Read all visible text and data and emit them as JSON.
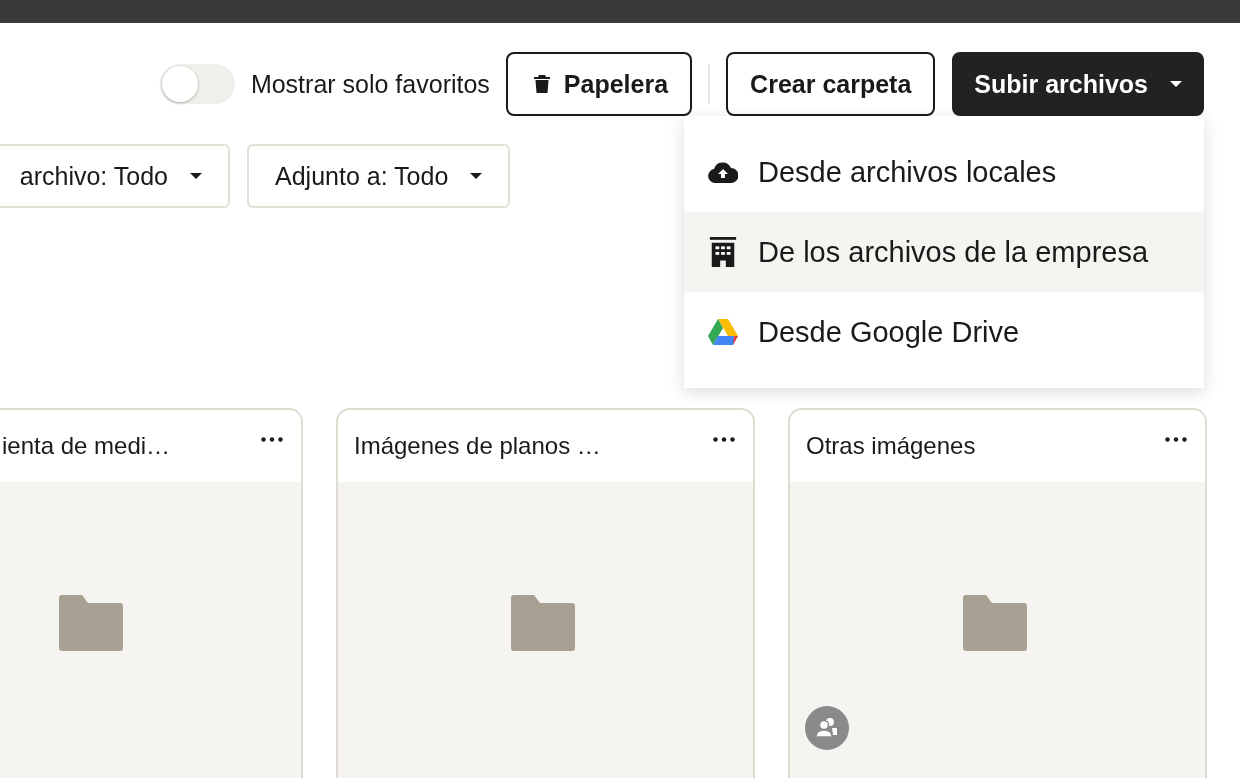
{
  "toolbar": {
    "favorites_toggle": {
      "label": "Mostrar solo favoritos",
      "on": false
    },
    "buttons": [
      {
        "label": "Papelera",
        "kind": "trash"
      },
      {
        "label": "Crear carpeta",
        "kind": "outline"
      },
      {
        "label": "Subir archivos",
        "kind": "dropdown"
      }
    ]
  },
  "filters": [
    {
      "label": "archivo: Todo"
    },
    {
      "label": "Adjunto a: Todo"
    }
  ],
  "upload_menu": {
    "items": [
      {
        "label": "Desde archivos locales",
        "kind": "cloud",
        "highlighted": false
      },
      {
        "label": "De los archivos de la empresa",
        "kind": "building",
        "highlighted": true
      },
      {
        "label": "Desde Google Drive",
        "kind": "drive",
        "highlighted": false
      }
    ]
  },
  "folders": [
    {
      "name": "ienta de medi…",
      "shared": false
    },
    {
      "name": "Imágenes de planos …",
      "shared": false
    },
    {
      "name": "Otras imágenes",
      "shared": true
    }
  ]
}
